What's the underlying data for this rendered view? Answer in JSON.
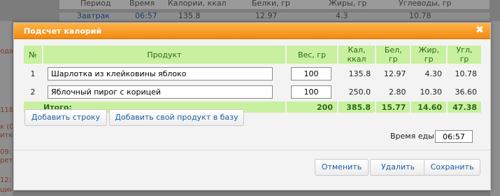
{
  "background": {
    "header": [
      "Период",
      "Время",
      "Калории, ккал",
      "Белки, гр",
      "Жиры, гр",
      "Углеводы, гр"
    ],
    "row": [
      "Завтрак",
      "06:57",
      "135.8",
      "12.97",
      "4.3",
      "10.78"
    ],
    "left_fragments": [
      "ода",
      "118",
      "к (0",
      "итка",
      "09:",
      "рет",
      "12:",
      "цин с"
    ]
  },
  "dialog": {
    "title": "Подсчет калорий",
    "table": {
      "headers": [
        "№",
        "Продукт",
        "Вес, гр",
        "Кал, ккал",
        "Бел, гр",
        "Жир, гр",
        "Угл, гр"
      ],
      "rows": [
        {
          "num": "1",
          "product": "Шарлотка из клейковины яблоко",
          "weight": "100",
          "kcal": "135.8",
          "protein": "12.97",
          "fat": "4.30",
          "carbs": "10.78"
        },
        {
          "num": "2",
          "product": "Яблочный пирог с корицей",
          "weight": "100",
          "kcal": "250.0",
          "protein": "2.80",
          "fat": "10.30",
          "carbs": "36.60"
        }
      ],
      "total": {
        "label": "Итого:",
        "weight": "200",
        "kcal": "385.8",
        "protein": "15.77",
        "fat": "14.60",
        "carbs": "47.38"
      }
    },
    "add_row_label": "Добавить строку",
    "add_product_label": "Добавить свой продукт в базу",
    "meal_time_label": "Время еды:",
    "meal_time_value": "06:57",
    "cancel_label": "Отменить",
    "delete_label": "Удалить",
    "save_label": "Сохранить",
    "colors": {
      "titlebar": "#f18a12",
      "table_header": "#c8f0a0",
      "link_text": "#1f5fa3"
    }
  }
}
